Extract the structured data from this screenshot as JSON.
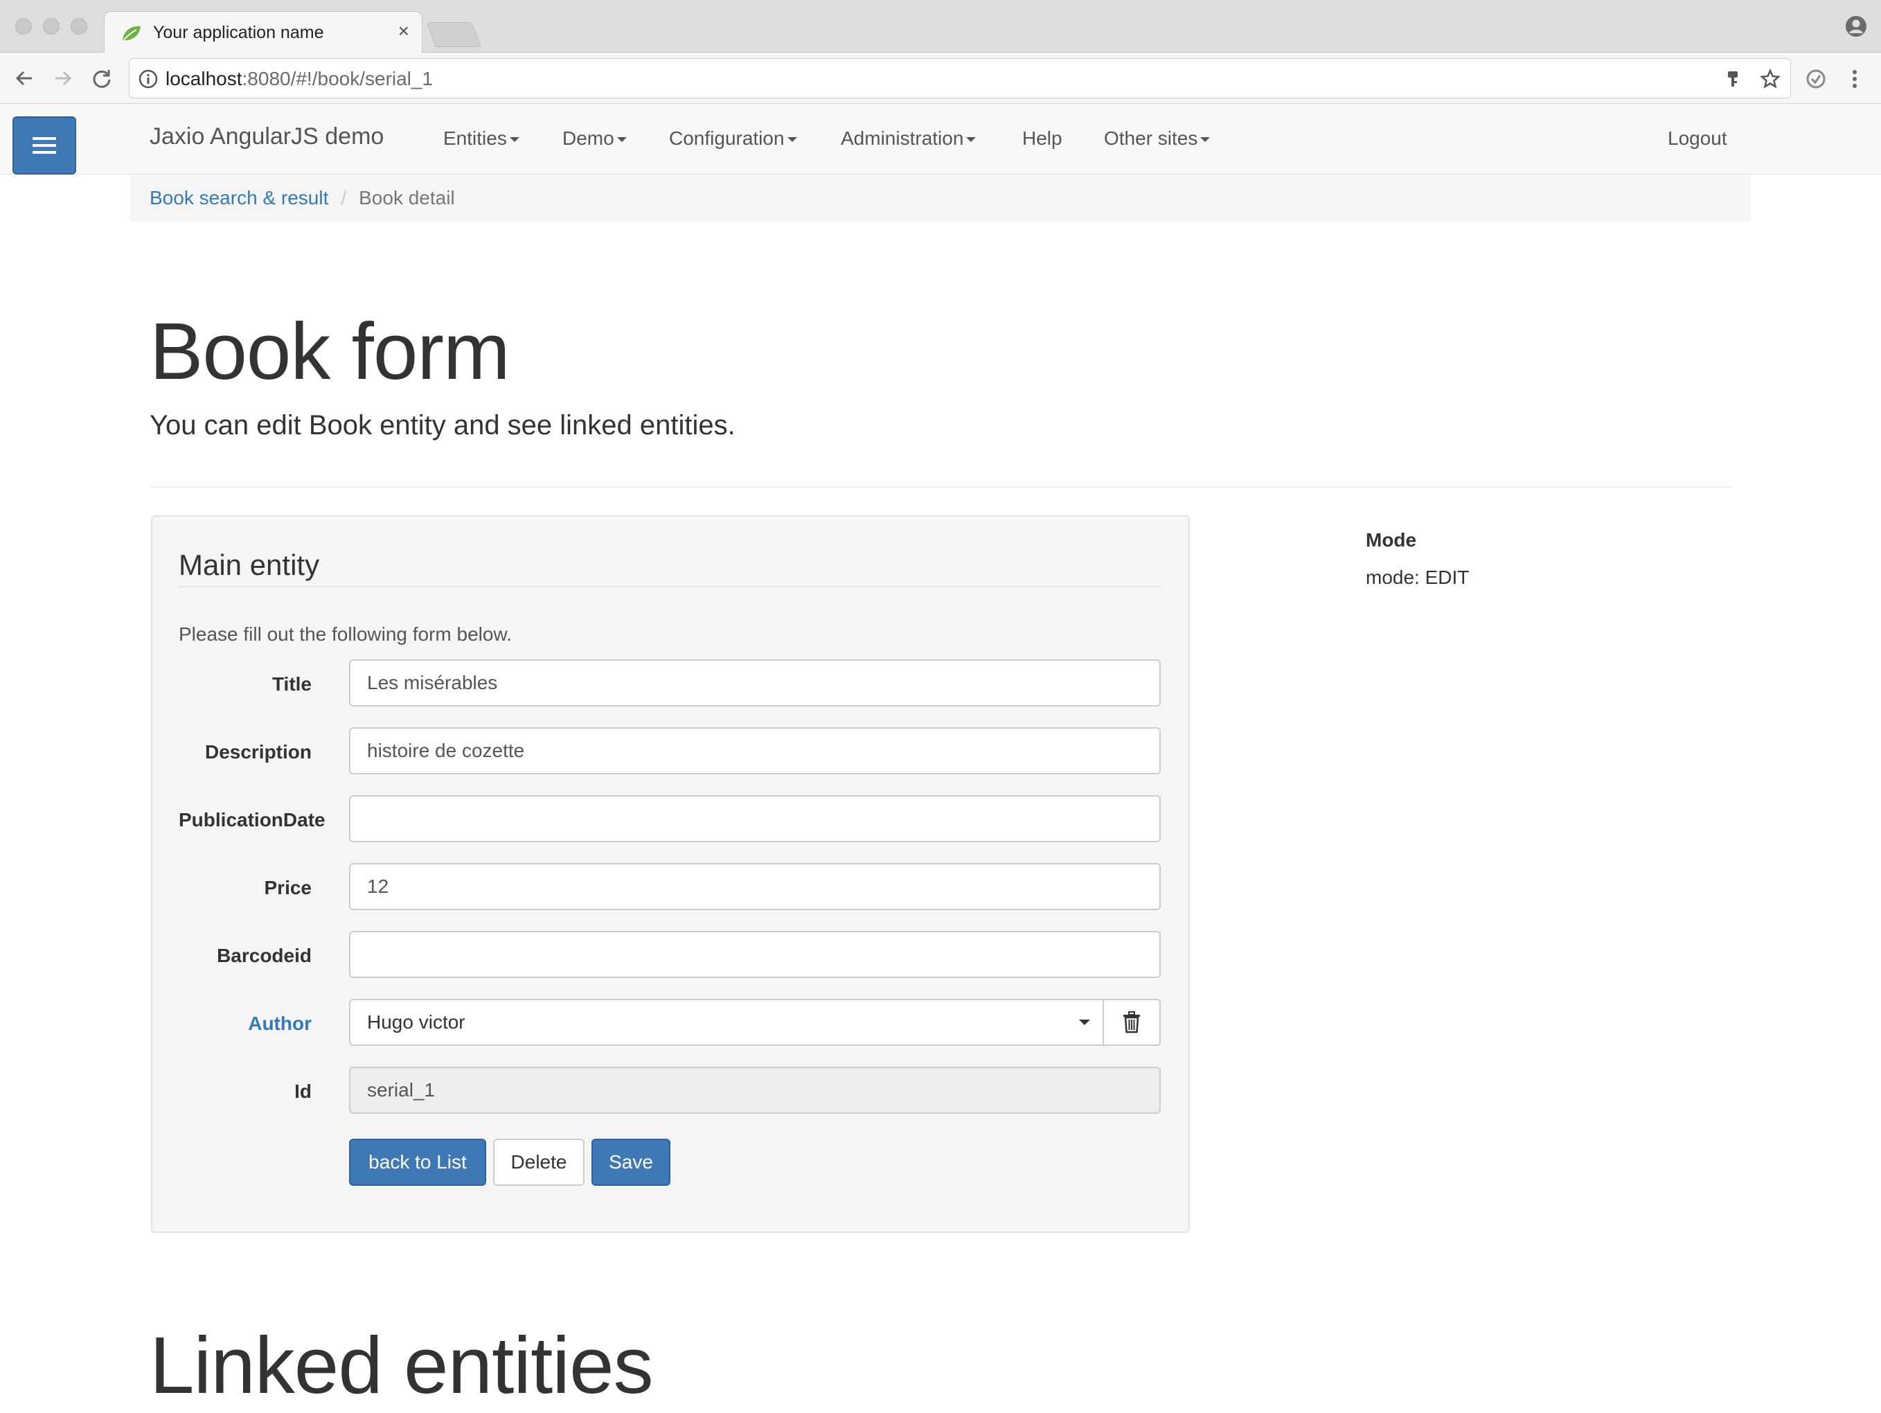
{
  "browser": {
    "tab_title": "Your application name",
    "url_host": "localhost",
    "url_rest": ":8080/#!/book/serial_1"
  },
  "navbar": {
    "brand": "Jaxio AngularJS demo",
    "items": [
      {
        "label": "Entities",
        "dropdown": true
      },
      {
        "label": "Demo",
        "dropdown": true
      },
      {
        "label": "Configuration",
        "dropdown": true
      },
      {
        "label": "Administration",
        "dropdown": true
      },
      {
        "label": "Help",
        "dropdown": false
      },
      {
        "label": "Other sites",
        "dropdown": true
      }
    ],
    "logout": "Logout"
  },
  "breadcrumb": {
    "link": "Book search & result",
    "separator": "/",
    "active": "Book detail"
  },
  "page": {
    "title": "Book form",
    "subtitle": "You can edit Book entity and see linked entities."
  },
  "form": {
    "legend": "Main entity",
    "help": "Please fill out the following form below.",
    "fields": {
      "title": {
        "label": "Title",
        "value": "Les misérables"
      },
      "description": {
        "label": "Description",
        "value": "histoire de cozette"
      },
      "publication_date": {
        "label": "PublicationDate",
        "value": ""
      },
      "price": {
        "label": "Price",
        "value": "12"
      },
      "barcodeid": {
        "label": "Barcodeid",
        "value": ""
      },
      "author": {
        "label": "Author",
        "value": "Hugo victor"
      },
      "id": {
        "label": "Id",
        "value": "serial_1"
      }
    },
    "buttons": {
      "back": "back to List",
      "delete": "Delete",
      "save": "Save"
    }
  },
  "mode": {
    "title": "Mode",
    "value": "mode: EDIT"
  },
  "linked": {
    "title": "Linked entities"
  },
  "colors": {
    "primary": "#3f79b5",
    "link": "#337ab7",
    "navbar_bg": "#f8f8f8",
    "panel_bg": "#f5f5f5"
  }
}
